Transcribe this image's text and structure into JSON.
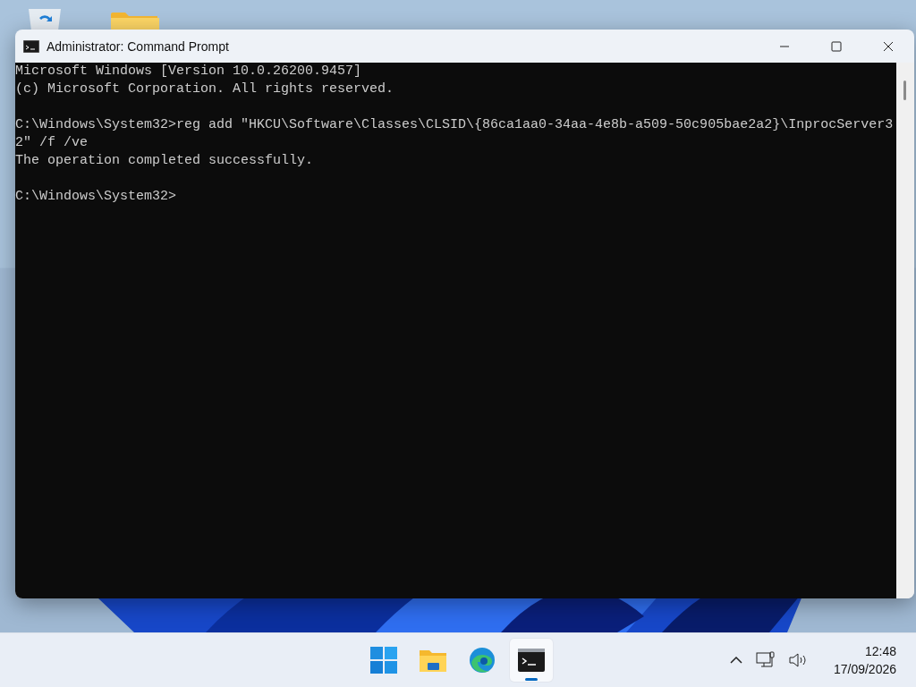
{
  "window": {
    "title": "Administrator: Command Prompt",
    "console_blocks": [
      [
        "Microsoft Windows [Version 10.0.26200.9457]",
        "(c) Microsoft Corporation. All rights reserved."
      ],
      [
        "C:\\Windows\\System32>reg add \"HKCU\\Software\\Classes\\CLSID\\{86ca1aa0-34aa-4e8b-a509-50c905bae2a2}\\InprocServer3",
        "2\" /f /ve",
        "The operation completed successfully."
      ],
      [
        "C:\\Windows\\System32>"
      ]
    ]
  },
  "taskbar": {
    "apps": [
      {
        "kind": "start",
        "selected": false
      },
      {
        "kind": "explorer",
        "selected": false
      },
      {
        "kind": "edge",
        "selected": false
      },
      {
        "kind": "terminal",
        "selected": true
      }
    ],
    "clock": {
      "time": "12:48",
      "date": "17/09/2026"
    }
  }
}
